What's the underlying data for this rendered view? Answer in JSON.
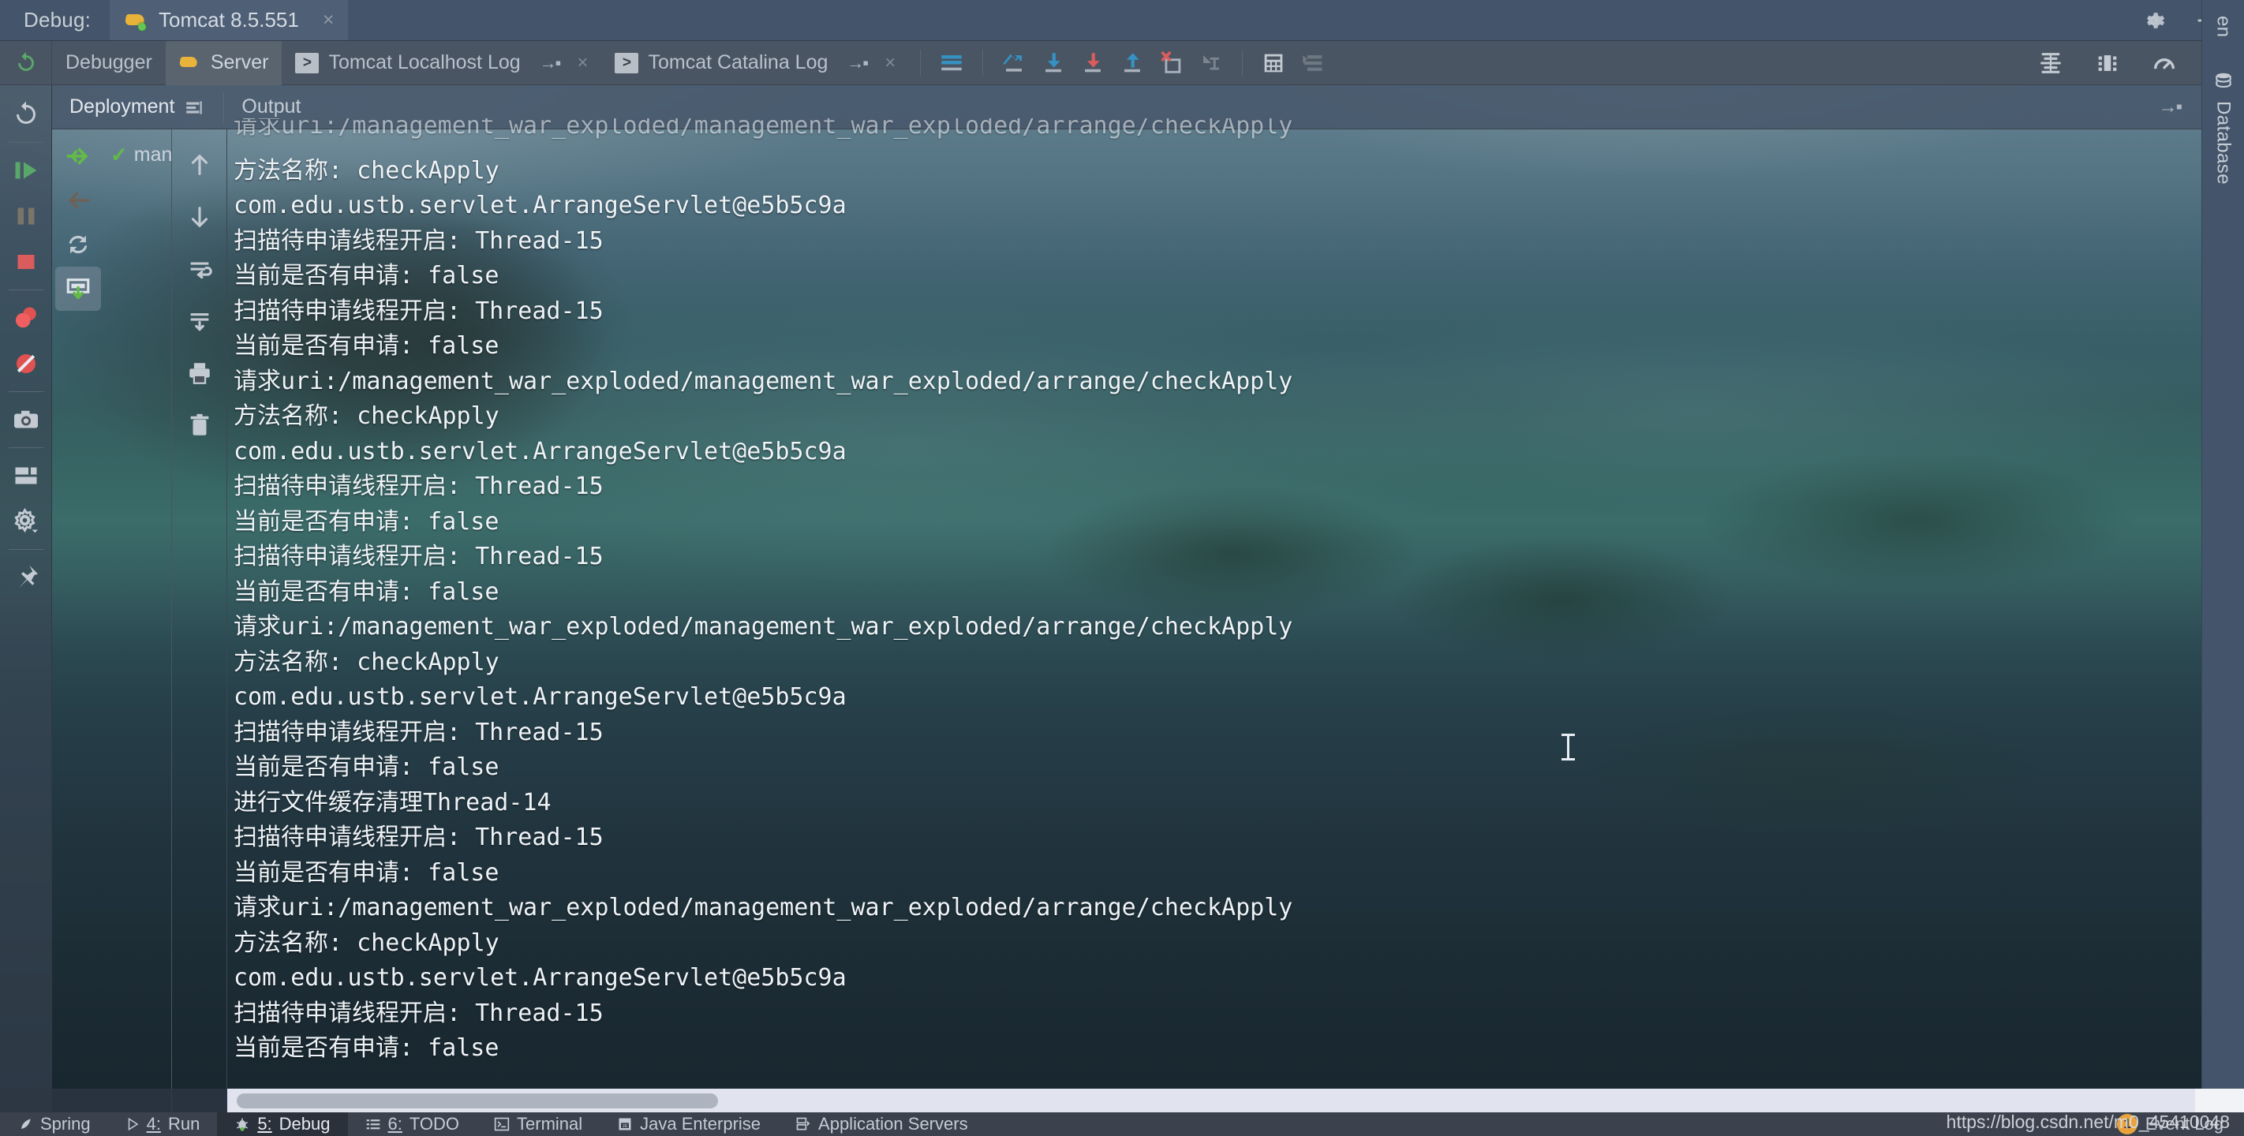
{
  "titlebar": {
    "label": "Debug:",
    "tab_title": "Tomcat 8.5.551",
    "tab_icon": "tomcat-cat-icon",
    "close_glyph": "×",
    "settings_icon": "gear-icon",
    "minimize_icon": "minimize-icon"
  },
  "tool_tabs": {
    "rerun_icon": "rerun-icon",
    "items": [
      {
        "label": "Debugger",
        "icon": "",
        "active": false,
        "detach": false
      },
      {
        "label": "Server",
        "icon": "tomcat-cat-icon",
        "active": true,
        "detach": false
      },
      {
        "label": "Tomcat Localhost Log",
        "icon": "console-log-icon",
        "active": false,
        "detach": true
      },
      {
        "label": "Tomcat Catalina Log",
        "icon": "console-log-icon",
        "active": false,
        "detach": true
      }
    ],
    "detach_glyph": "→▪",
    "close_glyph": "×",
    "buttons": [
      {
        "name": "scroll-to-end-icon"
      },
      {
        "name": "restore-layout-icon"
      },
      {
        "name": "scroll-down-icon"
      },
      {
        "name": "scroll-to-bottom-red-icon"
      },
      {
        "name": "scroll-up-icon"
      },
      {
        "name": "clear-all-icon"
      },
      {
        "name": "soft-wrap-icon"
      },
      {
        "name": "print-table-icon"
      },
      {
        "name": "settings-list-icon"
      }
    ],
    "right_buttons": [
      {
        "name": "threads-icon"
      },
      {
        "name": "memory-view-icon"
      },
      {
        "name": "profiler-icon"
      }
    ]
  },
  "sub_tabs": {
    "items": [
      {
        "label": "Deployment",
        "active": true,
        "icon": "deployment-icon"
      },
      {
        "label": "Output",
        "active": false,
        "icon": ""
      }
    ],
    "collapse_glyph": "→▪"
  },
  "left_rail": {
    "buttons": [
      {
        "name": "rerun-icon"
      },
      {
        "name": "resume-program-icon"
      },
      {
        "name": "pause-program-icon"
      },
      {
        "name": "stop-icon"
      },
      {
        "name": "mute-breakpoints-icon"
      },
      {
        "name": "view-breakpoints-icon"
      },
      {
        "name": "screenshot-icon"
      },
      {
        "name": "layout-settings-icon"
      },
      {
        "name": "settings-gear-icon"
      },
      {
        "name": "pin-tab-icon"
      }
    ]
  },
  "deploy_rail": {
    "buttons": [
      {
        "name": "deploy-all-icon"
      },
      {
        "name": "undeploy-icon"
      },
      {
        "name": "redeploy-icon"
      },
      {
        "name": "update-resources-icon",
        "selected": true
      }
    ]
  },
  "deployment_list": {
    "items": [
      {
        "check": "✓",
        "label": "man"
      }
    ]
  },
  "console_tools": {
    "buttons": [
      {
        "name": "up-arrow-icon"
      },
      {
        "name": "down-arrow-icon"
      },
      {
        "name": "soft-wrap-icon"
      },
      {
        "name": "scroll-to-end-icon"
      },
      {
        "name": "print-icon"
      },
      {
        "name": "trash-icon"
      }
    ]
  },
  "console": {
    "clipped_top_line": "请求uri:/management_war_exploded/management_war_exploded/arrange/checkApply",
    "lines": [
      "方法名称: checkApply",
      "com.edu.ustb.servlet.ArrangeServlet@e5b5c9a",
      "扫描待申请线程开启: Thread-15",
      "当前是否有申请: false",
      "扫描待申请线程开启: Thread-15",
      "当前是否有申请: false",
      "请求uri:/management_war_exploded/management_war_exploded/arrange/checkApply",
      "方法名称: checkApply",
      "com.edu.ustb.servlet.ArrangeServlet@e5b5c9a",
      "扫描待申请线程开启: Thread-15",
      "当前是否有申请: false",
      "扫描待申请线程开启: Thread-15",
      "当前是否有申请: false",
      "请求uri:/management_war_exploded/management_war_exploded/arrange/checkApply",
      "方法名称: checkApply",
      "com.edu.ustb.servlet.ArrangeServlet@e5b5c9a",
      "扫描待申请线程开启: Thread-15",
      "当前是否有申请: false",
      "进行文件缓存清理Thread-14",
      "扫描待申请线程开启: Thread-15",
      "当前是否有申请: false",
      "请求uri:/management_war_exploded/management_war_exploded/arrange/checkApply",
      "方法名称: checkApply",
      "com.edu.ustb.servlet.ArrangeServlet@e5b5c9a",
      "扫描待申请线程开启: Thread-15",
      "当前是否有申请: false"
    ]
  },
  "right_sidebar": {
    "tabs": [
      {
        "label": "en",
        "icon": "",
        "partial": true
      },
      {
        "label": "Database",
        "icon": "database-icon",
        "partial": false
      }
    ]
  },
  "status_bar": {
    "items": [
      {
        "label": "Spring",
        "icon": "spring-leaf-icon",
        "num": "",
        "active": false
      },
      {
        "label": "Run",
        "icon": "run-icon",
        "num": "4:",
        "active": false
      },
      {
        "label": "Debug",
        "icon": "debug-bug-icon",
        "num": "5:",
        "active": true
      },
      {
        "label": "TODO",
        "icon": "todo-list-icon",
        "num": "6:",
        "active": false
      },
      {
        "label": "Terminal",
        "icon": "terminal-icon",
        "num": "",
        "active": false
      },
      {
        "label": "Java Enterprise",
        "icon": "java-enterprise-icon",
        "num": "",
        "active": false
      },
      {
        "label": "Application Servers",
        "icon": "app-servers-icon",
        "num": "",
        "active": false
      }
    ],
    "event_log_label": "Event Log",
    "event_log_badge": "1",
    "watermark": "https://blog.csdn.net/m0_45410048"
  },
  "colors": {
    "accent_blue": "#3592c4",
    "accent_red": "#db5c5c",
    "accent_green": "#62bb46",
    "titlebar_bg": "#44546a",
    "toolrow_bg": "#4a5563",
    "status_bg": "#3b424d"
  }
}
